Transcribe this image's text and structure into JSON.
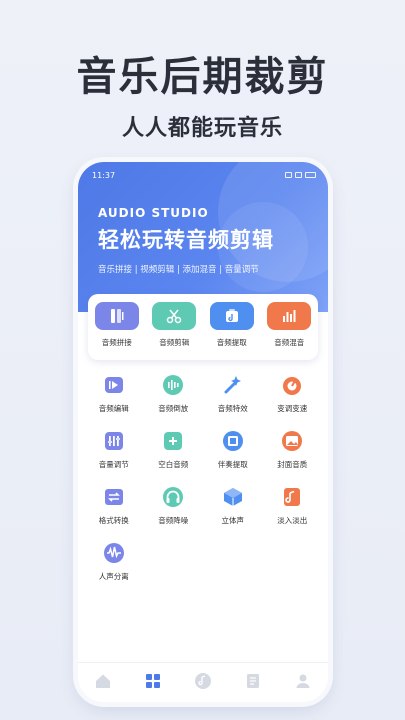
{
  "hero": {
    "title": "音乐后期裁剪",
    "subtitle": "人人都能玩音乐"
  },
  "status_bar": {
    "time": "11:37"
  },
  "banner": {
    "brand": "AUDIO STUDIO",
    "title": "轻松玩转音频剪辑",
    "tags": "音乐拼接 | 视频剪辑 | 添加混音 | 音量调节"
  },
  "featured": [
    {
      "label": "音频拼接",
      "icon": "splice-icon",
      "color": "#7b86e8"
    },
    {
      "label": "音频剪辑",
      "icon": "scissors-icon",
      "color": "#5fcab4"
    },
    {
      "label": "音频提取",
      "icon": "extract-icon",
      "color": "#4f8ff0"
    },
    {
      "label": "音频混音",
      "icon": "mixer-icon",
      "color": "#f0784a"
    }
  ],
  "tools": [
    {
      "label": "音频编辑",
      "icon": "edit-icon"
    },
    {
      "label": "音频倒放",
      "icon": "reverse-icon"
    },
    {
      "label": "音频特效",
      "icon": "magic-icon"
    },
    {
      "label": "变调变速",
      "icon": "pitch-icon"
    },
    {
      "label": "音量调节",
      "icon": "volume-icon"
    },
    {
      "label": "空白音频",
      "icon": "blank-audio-icon"
    },
    {
      "label": "伴奏提取",
      "icon": "accompaniment-icon"
    },
    {
      "label": "封面音质",
      "icon": "cover-icon"
    },
    {
      "label": "格式转换",
      "icon": "format-icon"
    },
    {
      "label": "音频降噪",
      "icon": "denoise-icon"
    },
    {
      "label": "立体声",
      "icon": "stereo-icon"
    },
    {
      "label": "淡入淡出",
      "icon": "fade-icon"
    },
    {
      "label": "人声分离",
      "icon": "vocal-split-icon"
    }
  ],
  "tabs": [
    {
      "icon": "home-icon",
      "active": false
    },
    {
      "icon": "grid-icon",
      "active": true
    },
    {
      "icon": "music-icon",
      "active": false
    },
    {
      "icon": "document-icon",
      "active": false
    },
    {
      "icon": "profile-icon",
      "active": false
    }
  ]
}
